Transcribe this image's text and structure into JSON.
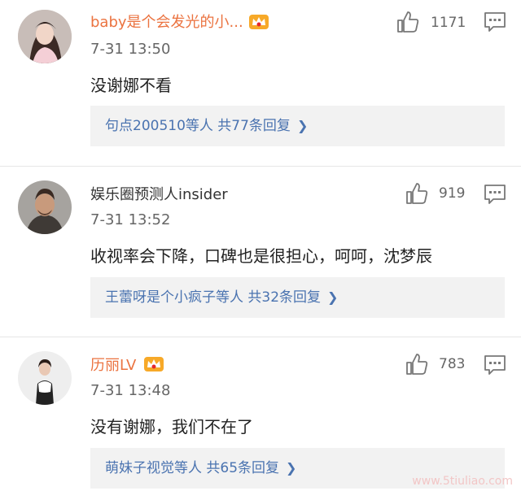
{
  "comments": [
    {
      "username": "baby是个会发光的小...",
      "time": "7-31 13:50",
      "text": "没谢娜不看",
      "likes": "1171",
      "reply": "句点200510等人 共77条回复",
      "vip": true,
      "avatar": "female-avatar-1"
    },
    {
      "username": "娱乐圈预测人insider",
      "time": "7-31 13:52",
      "text": "收视率会下降，口碑也是很担心，呵呵，沈梦辰",
      "likes": "919",
      "reply": "王蕾呀是个小疯子等人 共32条回复",
      "vip": false,
      "avatar": "male-avatar"
    },
    {
      "username": "历丽LV",
      "time": "7-31 13:48",
      "text": "没有谢娜，我们不在了",
      "likes": "783",
      "reply": "萌妹子视觉等人 共65条回复",
      "vip": true,
      "avatar": "female-avatar-2"
    }
  ],
  "watermark": "www.5tiuliao.com",
  "colors": {
    "vip_name": "#eb7340",
    "reply_link": "#4a73b0",
    "reply_bg": "#f2f2f2"
  },
  "icons": [
    "thumbs-up-icon",
    "comment-icon",
    "crown-badge-icon",
    "chevron-right-icon"
  ]
}
